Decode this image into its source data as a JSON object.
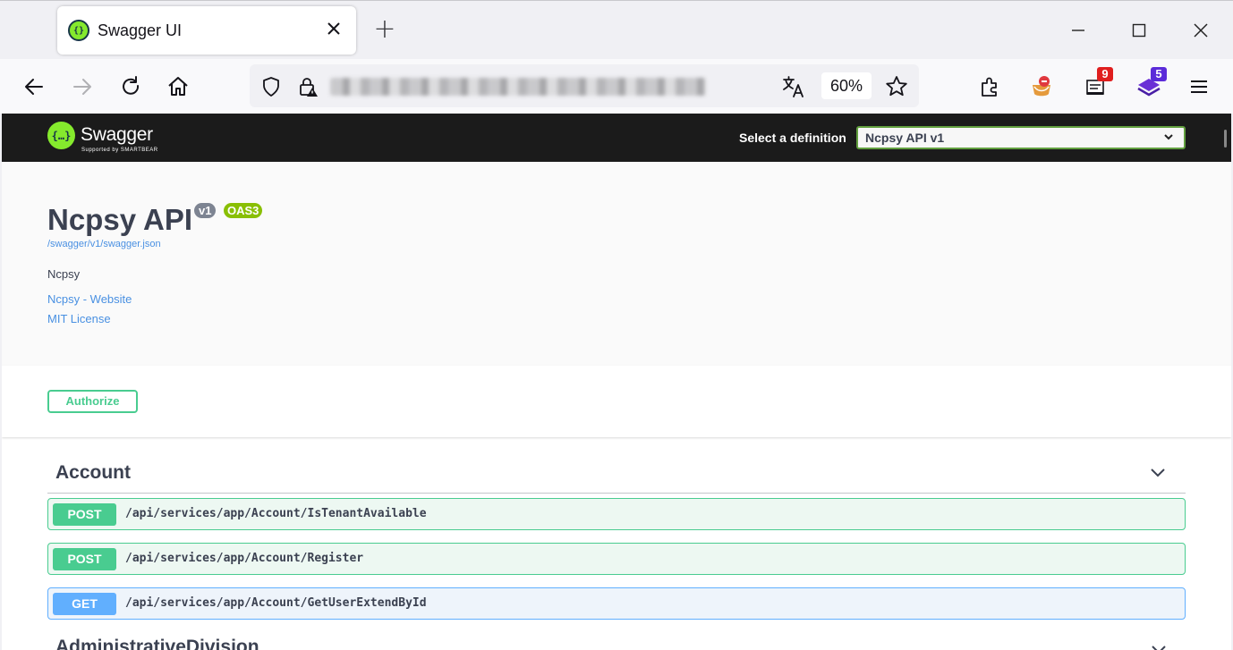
{
  "browser": {
    "tab_title": "Swagger UI",
    "tab_favicon_icon": "swagger-icon",
    "new_tab_label": "+",
    "zoom": "60%",
    "extensions": [
      {
        "name": "ublock-icon",
        "badge": ""
      },
      {
        "name": "reader-extension-icon",
        "badge": "9",
        "badge_color": "#e01e1e"
      },
      {
        "name": "layers-extension-icon",
        "badge": "5",
        "badge_color": "#5b2bd9"
      }
    ]
  },
  "swagger": {
    "logo_text": "Swagger",
    "logo_sub": "Supported by SMARTBEAR",
    "logo_mark": "{…}",
    "definition_label": "Select a definition",
    "definition_value": "Ncpsy API v1"
  },
  "info": {
    "title": "Ncpsy API",
    "version": "v1",
    "oas": "OAS3",
    "spec_url": "/swagger/v1/swagger.json",
    "description": "Ncpsy",
    "website_link": "Ncpsy - Website",
    "license_link": "MIT License"
  },
  "authorize_label": "Authorize",
  "tags": [
    {
      "name": "Account",
      "operations": [
        {
          "method": "POST",
          "path": "/api/services/app/Account/IsTenantAvailable"
        },
        {
          "method": "POST",
          "path": "/api/services/app/Account/Register"
        },
        {
          "method": "GET",
          "path": "/api/services/app/Account/GetUserExtendById"
        }
      ]
    },
    {
      "name": "AdministrativeDivision",
      "operations": []
    }
  ],
  "colors": {
    "post": "#49cc90",
    "get": "#61affe",
    "topbar": "#1b1b1b",
    "link": "#4990e2"
  }
}
